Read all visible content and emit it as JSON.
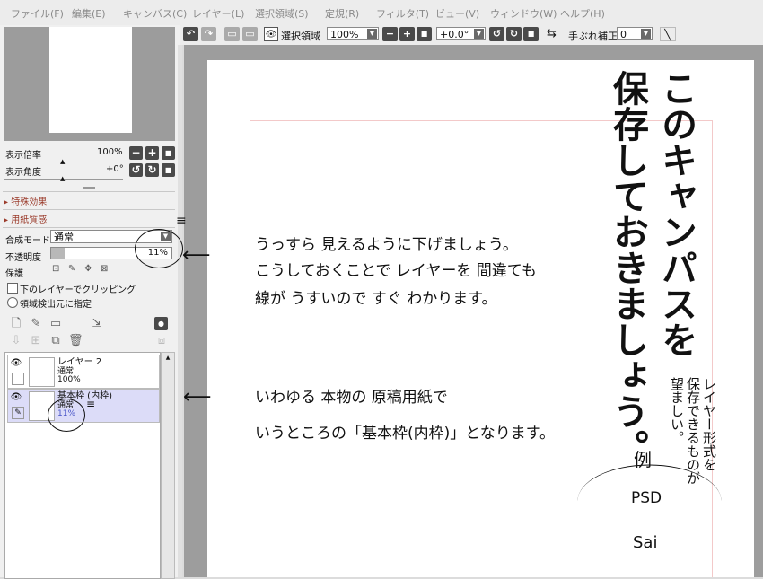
{
  "menubar": {
    "items": [
      "ファイル(F)",
      "編集(E)",
      "キャンバス(C)",
      "レイヤー(L)",
      "選択領域(S)",
      "定規(R)",
      "フィルタ(T)",
      "ビュー(V)",
      "ウィンドウ(W)",
      "ヘルプ(H)"
    ]
  },
  "toolbar": {
    "selection_label": "選択領域",
    "zoom_value": "100%",
    "angle_value": "+0.0°",
    "stabilizer_label": "手ぶれ補正",
    "stabilizer_value": "0"
  },
  "navigator": {
    "zoom_label": "表示倍率",
    "zoom_value": "100%",
    "angle_label": "表示角度",
    "angle_value": "+0°"
  },
  "sections": {
    "special_effects": "特殊効果",
    "paper_texture": "用紙質感"
  },
  "layer_props": {
    "blend_label": "合成モード",
    "blend_value": "通常",
    "opacity_label": "不透明度",
    "opacity_value": "11%",
    "opacity_fraction": 0.11,
    "protect_label": "保護",
    "clip_label": "下のレイヤーでクリッピング",
    "selection_source_label": "領域検出元に指定"
  },
  "layers": [
    {
      "name": "レイヤー 2",
      "mode": "通常",
      "opacity": "100%",
      "selected": false
    },
    {
      "name": "基本枠 (内枠)",
      "mode": "通常",
      "opacity": "11%",
      "selected": true
    }
  ],
  "annotations": {
    "note1_line1": "うっすら 見えるように下げましょう。",
    "note1_line2": "こうしておくことで レイヤーを 間違ても",
    "note1_line3": "線が うすいので すぐ わかります。",
    "note2_line1": "いわゆる 本物の 原稿用紙で",
    "note2_line2": "いうところの「基本枠(内枠)」となります。",
    "vertical_col1": "このキャンパスを",
    "vertical_col2": "保存しておきましょう。",
    "vertical_small1": "レイヤー形式を",
    "vertical_small2": "保存できるものが",
    "vertical_small3": "望ましい。",
    "example": "例",
    "psd": "PSD",
    "sai": "Sai"
  },
  "colors": {
    "section_text": "#9b3b2b",
    "selected_layer": "#dcdcf8",
    "frame_guide": "#f3c9c9"
  }
}
